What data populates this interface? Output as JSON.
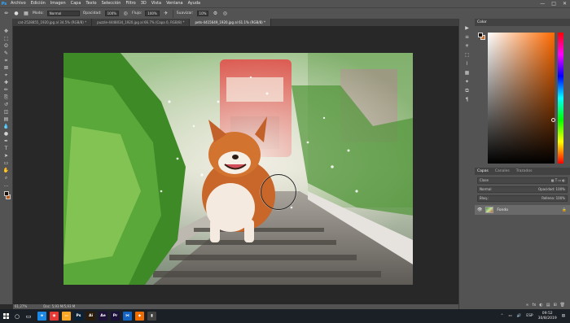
{
  "menu": {
    "logo": "Ps",
    "items": [
      "Archivo",
      "Edición",
      "Imagen",
      "Capa",
      "Texto",
      "Selección",
      "Filtro",
      "3D",
      "Vista",
      "Ventana",
      "Ayuda"
    ],
    "window_controls": [
      "—",
      "□",
      "✕"
    ]
  },
  "options": {
    "mode_label": "Modo:",
    "mode_value": "Normal",
    "opacity_label": "Opacidad:",
    "opacity_value": "100%",
    "flow_label": "Flujo:",
    "flow_value": "100%",
    "smoothing_label": "Suavizar:",
    "smoothing_value": "10%"
  },
  "tabs": [
    {
      "label": "cat-2528855_1920.jpg al 34.5% (RGB/8) *",
      "active": false
    },
    {
      "label": "puzzle-4448034_1920.jpg al 66.7% (Capa 0, RGB/8) *",
      "active": false
    },
    {
      "label": "pets-4415649_1920.jpg al 61.1% (RGB/8) *",
      "active": true
    }
  ],
  "toolbar": {
    "tools": [
      "move-tool",
      "marquee-tool",
      "lasso-tool",
      "quick-select-tool",
      "crop-tool",
      "frame-tool",
      "eyedropper-tool",
      "healing-tool",
      "brush-tool",
      "stamp-tool",
      "history-brush-tool",
      "eraser-tool",
      "gradient-tool",
      "blur-tool",
      "dodge-tool",
      "pen-tool",
      "type-tool",
      "path-select-tool",
      "shape-tool",
      "hand-tool",
      "zoom-tool",
      "more-tools"
    ],
    "glyphs": [
      "✥",
      "⬚",
      "ʘ",
      "✎",
      "⌗",
      "⊠",
      "⌖",
      "✚",
      "✏",
      "⎘",
      "↺",
      "◫",
      "▤",
      "💧",
      "●",
      "✒",
      "T",
      "➤",
      "▭",
      "✋",
      "⌕",
      "…"
    ]
  },
  "status": {
    "zoom": "61,27%",
    "doc": "Doc: 5,93 M/5,93 M"
  },
  "panels": {
    "color_tab": "Color",
    "layers_tabs": [
      "Capas",
      "Canales",
      "Trazados"
    ],
    "kind_label": "Clase",
    "blend_value": "Normal",
    "opacity_label": "Opacidad: 100%",
    "lock_label": "Bloq.:",
    "fill_label": "Relleno: 100%",
    "layer_name": "Fondo",
    "foot_icons": [
      "∞",
      "fx",
      "◐",
      "▤",
      "⊞",
      "🗑"
    ]
  },
  "minicol": {
    "glyphs": [
      "▶",
      "≡",
      "☀",
      "⬚",
      "⌇",
      "▦",
      "✦",
      "⧉",
      "¶"
    ]
  },
  "taskbar": {
    "apps": [
      {
        "label": "e",
        "color": "#1e88e5"
      },
      {
        "label": "◉",
        "color": "#e53935"
      },
      {
        "label": "▭",
        "color": "#f9a825"
      },
      {
        "label": "Ps",
        "color": "#0b2135"
      },
      {
        "label": "Ai",
        "color": "#2b1b0b"
      },
      {
        "label": "Ae",
        "color": "#1f1138"
      },
      {
        "label": "Pr",
        "color": "#1a1038"
      },
      {
        "label": "⋈",
        "color": "#1565c0"
      },
      {
        "label": "◆",
        "color": "#ef6c00"
      },
      {
        "label": "▮",
        "color": "#424242"
      }
    ],
    "lang": "ESP",
    "time": "09:52",
    "date": "30/8/2019"
  },
  "colors": {
    "accent": "#31a8ff",
    "ui_dark": "#282828",
    "ui_mid": "#535353"
  }
}
